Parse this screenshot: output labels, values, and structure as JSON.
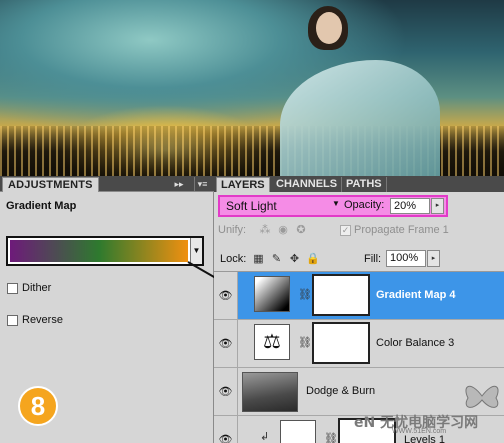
{
  "adjustments": {
    "tab_label": "ADJUSTMENTS",
    "collapse_icon": "▸▸",
    "menu_icon": "▾≡",
    "title": "Gradient Map",
    "gradient_colors": [
      "#6e1a7a",
      "#2e7a2e",
      "#f09010"
    ],
    "dither_label": "Dither",
    "reverse_label": "Reverse",
    "step_number": "8"
  },
  "layers": {
    "tabs": [
      {
        "label": "LAYERS",
        "active": true
      },
      {
        "label": "CHANNELS",
        "active": false
      },
      {
        "label": "PATHS",
        "active": false
      }
    ],
    "blend_mode": "Soft Light",
    "opacity_label": "Opacity:",
    "opacity_value": "20%",
    "unify_label": "Unify:",
    "propagate_label": "Propagate Frame 1",
    "lock_label": "Lock:",
    "fill_label": "Fill:",
    "fill_value": "100%",
    "items": [
      {
        "name": "Gradient Map 4",
        "selected": true
      },
      {
        "name": "Color Balance 3",
        "selected": false
      },
      {
        "name": "Dodge & Burn",
        "selected": false
      },
      {
        "name": "Levels 1",
        "selected": false
      }
    ]
  },
  "watermark": {
    "text": "eN 无忧电脑学习网",
    "url": "WWW.51EN.com"
  },
  "colors": {
    "selection": "#3d95e8",
    "highlight_border": "#e23ac8",
    "highlight_fill": "#f58ce6",
    "badge": "#f5a51e"
  }
}
